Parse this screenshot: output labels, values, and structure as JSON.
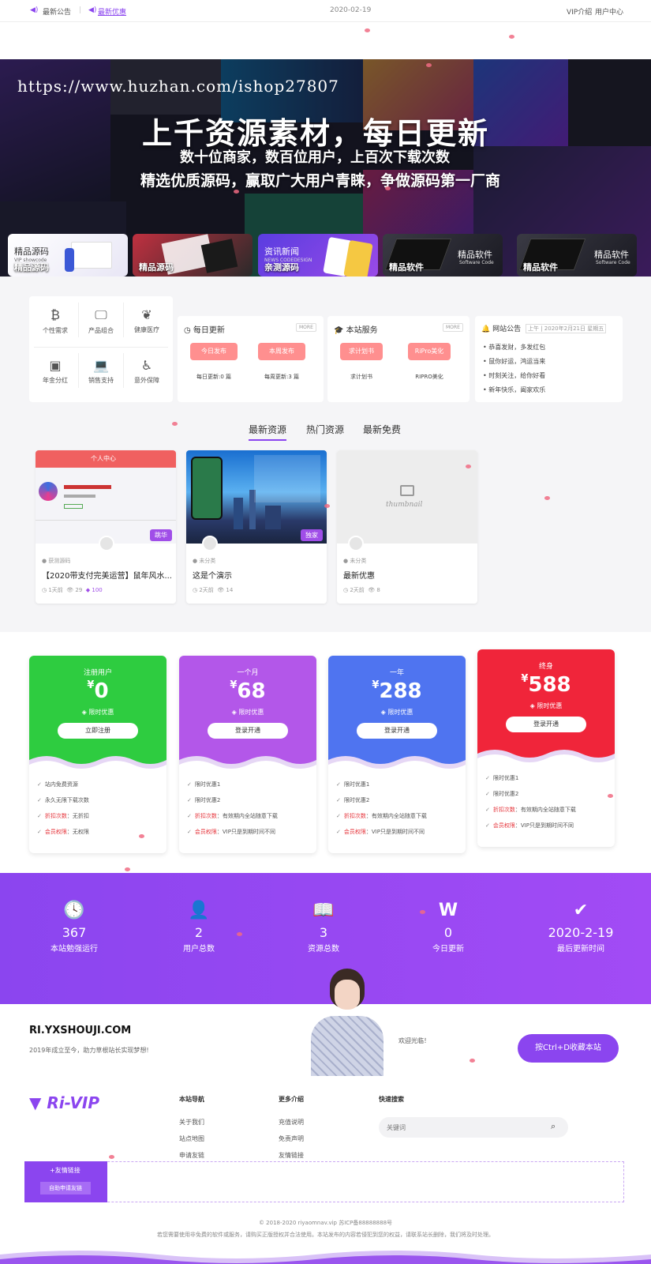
{
  "topbar": {
    "notice_label": "最新公告",
    "notice_link": "最新优惠",
    "date": "2020-02-19",
    "vip_link": "VIP介绍",
    "user_link": "用户中心"
  },
  "hero": {
    "url": "https://www.huzhan.com/ishop27807",
    "title": "上千资源素材，每日更新",
    "line2": "数十位商家，数百位用户，上百次下载次数",
    "line3": "精选优质源码，赢取广大用户青睐，争做源码第一厂商"
  },
  "categories": [
    {
      "label": "精品源码",
      "title": "精品源码",
      "sub": "VIP showcode",
      "color": "#ffffff"
    },
    {
      "label": "精品源码",
      "title": "",
      "sub": "",
      "color": "#b02a35"
    },
    {
      "label": "亲测源码",
      "title": "资讯新闻",
      "sub": "NEWS CODEDESIGN",
      "color": "#6a3de0"
    },
    {
      "label": "精品软件",
      "title": "精品软件",
      "sub": "Software Code",
      "color": "#2a2a32"
    },
    {
      "label": "精品软件",
      "title": "精品软件",
      "sub": "Software Code",
      "color": "#2a2a32"
    }
  ],
  "quicklinks": [
    {
      "icon": "₿",
      "label": "个性需求"
    },
    {
      "icon": "🖵",
      "label": "产品组合"
    },
    {
      "icon": "❦",
      "label": "健康医疗"
    },
    {
      "icon": "▣",
      "label": "年金分红"
    },
    {
      "icon": "💻",
      "label": "销售支持"
    },
    {
      "icon": "♿",
      "label": "意外保障"
    }
  ],
  "daily": {
    "title": "每日更新",
    "more": "MORE",
    "items": [
      {
        "btn": "今日发布",
        "caption": "每日更新:0 篇"
      },
      {
        "btn": "本周发布",
        "caption": "每周更新:3 篇"
      }
    ]
  },
  "service": {
    "title": "本站服务",
    "more": "MORE",
    "items": [
      {
        "btn": "求计划书",
        "caption": "求计划书"
      },
      {
        "btn": "RiPro美化",
        "caption": "RIPRO美化"
      }
    ]
  },
  "notice": {
    "title": "网站公告",
    "date": "上午 | 2020年2月21日 星期五",
    "items": [
      "恭喜发财，多发红包",
      "鼠你好运，鸿运当来",
      "时刻关注，给你好看",
      "新年快乐，阖家欢乐"
    ]
  },
  "tabs": [
    "最新资源",
    "热门资源",
    "最新免费"
  ],
  "resources": [
    {
      "img_kind": "ui",
      "category": "获测源码",
      "title": "【2020带支付完美运营】鼠年风水...",
      "time": "1天前",
      "views": "29",
      "price": "100",
      "badge": "跳华",
      "img_label": "个人中心"
    },
    {
      "img_kind": "city",
      "category": "未分类",
      "title": "这是个演示",
      "time": "2天前",
      "views": "14",
      "price": "",
      "badge": "独家",
      "img_label": ""
    },
    {
      "img_kind": "thumb",
      "category": "未分类",
      "title": "最新优惠",
      "time": "2天前",
      "views": "8",
      "price": "",
      "badge": "",
      "img_label": "thumbnail"
    }
  ],
  "pricing": [
    {
      "name": "注册用户",
      "price": "0",
      "tag": "限时优惠",
      "button": "立即注册",
      "color": "#2ecc40",
      "items": [
        {
          "t": "站内免费资源",
          "red": ""
        },
        {
          "t": "永久无限下载次数",
          "red": ""
        },
        {
          "t": "：无折扣",
          "red": "折扣次数"
        },
        {
          "t": "：无权限",
          "red": "会员权限"
        }
      ]
    },
    {
      "name": "一个月",
      "price": "68",
      "tag": "限时优惠",
      "button": "登录开通",
      "color": "#b357e9",
      "items": [
        {
          "t": "限时优惠1",
          "red": ""
        },
        {
          "t": "限时优惠2",
          "red": ""
        },
        {
          "t": "：有效期内全站随意下载",
          "red": "折扣次数"
        },
        {
          "t": "：VIP只是到期时间不同",
          "red": "会员权限"
        }
      ]
    },
    {
      "name": "一年",
      "price": "288",
      "tag": "限时优惠",
      "button": "登录开通",
      "color": "#4f74f0",
      "items": [
        {
          "t": "限时优惠1",
          "red": ""
        },
        {
          "t": "限时优惠2",
          "red": ""
        },
        {
          "t": "：有效期内全站随意下载",
          "red": "折扣次数"
        },
        {
          "t": "：VIP只是到期时间不同",
          "red": "会员权限"
        }
      ]
    },
    {
      "name": "终身",
      "price": "588",
      "tag": "限时优惠",
      "button": "登录开通",
      "color": "#f0253a",
      "items": [
        {
          "t": "限时优惠1",
          "red": ""
        },
        {
          "t": "限时优惠2",
          "red": ""
        },
        {
          "t": "：有效期内全站随意下载",
          "red": "折扣次数"
        },
        {
          "t": "：VIP只是到期时间不同",
          "red": "会员权限"
        }
      ]
    }
  ],
  "stats": [
    {
      "icon": "🕓",
      "value": "367",
      "label": "本站勉强运行"
    },
    {
      "icon": "👤",
      "value": "2",
      "label": "用户总数"
    },
    {
      "icon": "📖",
      "value": "3",
      "label": "资源总数"
    },
    {
      "icon": "W",
      "value": "0",
      "label": "今日更新"
    },
    {
      "icon": "✔",
      "value": "2020-2-19",
      "label": "最后更新时间"
    }
  ],
  "promo": {
    "domain": "RI.YXSHOUJI.COM",
    "slogan": "2019年成立至今，助力草根站长实现梦想!",
    "welcome": "欢迎光临！",
    "button": "按Ctrl+D收藏本站"
  },
  "footer": {
    "logo": "Ri-VIP",
    "nav_title": "本站导航",
    "nav": [
      "关于我们",
      "站点地图",
      "申请友链"
    ],
    "more_title": "更多介绍",
    "more": [
      "充值说明",
      "免责声明",
      "友情链接"
    ],
    "search_title": "快速搜索",
    "search_placeholder": "关键词",
    "friend_title": "+友情链接",
    "friend_btn": "自助申请友链",
    "copyright": "© 2018-2020 riyaomnav.vip 苏ICP备88888888号",
    "disclaimer": "若您需要使用非免费的软件或服务，请购买正版授权并合法使用。本站发布的内容若侵犯到您的权益，请联系站长删除，我们将及时处理。"
  }
}
